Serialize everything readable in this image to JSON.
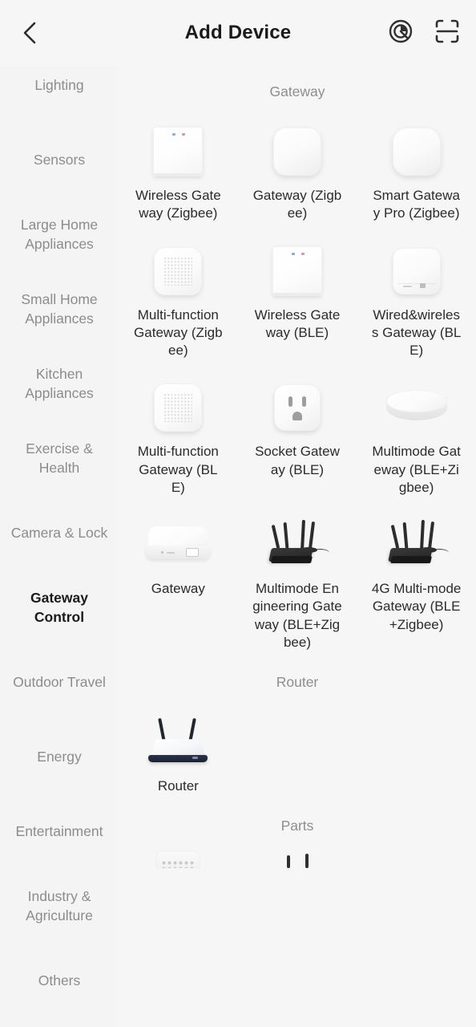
{
  "header": {
    "title": "Add Device",
    "back_icon": "chevron-left-icon",
    "auto_scan_icon": "target-scan-icon",
    "qr_scan_icon": "qr-scan-icon"
  },
  "sidebar": {
    "items": [
      {
        "label": "Lighting",
        "active": false,
        "clipped": true
      },
      {
        "label": "Sensors",
        "active": false
      },
      {
        "label": "Large Home Appliances",
        "active": false
      },
      {
        "label": "Small Home Appliances",
        "active": false
      },
      {
        "label": "Kitchen Appliances",
        "active": false
      },
      {
        "label": "Exercise & Health",
        "active": false
      },
      {
        "label": "Camera & Lock",
        "active": false
      },
      {
        "label": "Gateway Control",
        "active": true
      },
      {
        "label": "Outdoor Travel",
        "active": false
      },
      {
        "label": "Energy",
        "active": false
      },
      {
        "label": "Entertainment",
        "active": false
      },
      {
        "label": "Industry & Agriculture",
        "active": false
      },
      {
        "label": "Others",
        "active": false
      }
    ]
  },
  "content": {
    "sections": [
      {
        "title": "Gateway",
        "devices": [
          {
            "label": "Wireless Gateway (Zigbee)",
            "art": "square-gateway"
          },
          {
            "label": "Gateway (Zigbee)",
            "art": "rounded-gateway"
          },
          {
            "label": "Smart Gateway Pro (Zigbee)",
            "art": "rounded-gateway-pro"
          },
          {
            "label": "Multi-function Gateway (Zigbee)",
            "art": "mesh-gateway"
          },
          {
            "label": "Wireless Gateway (BLE)",
            "art": "square-gateway"
          },
          {
            "label": "Wired&wireless Gateway (BLE)",
            "art": "wired-gateway"
          },
          {
            "label": "Multi-function Gateway (BLE)",
            "art": "mesh-gateway"
          },
          {
            "label": "Socket Gateway (BLE)",
            "art": "socket-gateway"
          },
          {
            "label": "Multimode Gateway (BLE+Zigbee)",
            "art": "puck-gateway"
          },
          {
            "label": "Gateway",
            "art": "flat-box-gateway"
          },
          {
            "label": "Multimode Engineering Gateway (BLE+Zigbee)",
            "art": "black-router"
          },
          {
            "label": "4G Multi-mode Gateway (BLE+Zigbee)",
            "art": "black-router"
          }
        ]
      },
      {
        "title": "Router",
        "devices": [
          {
            "label": "Router",
            "art": "white-router"
          }
        ]
      },
      {
        "title": "Parts",
        "devices": []
      }
    ]
  },
  "colors": {
    "page_background": "#f6f6f6",
    "sidebar_background": "#f4f4f4",
    "active_text": "#1a1a1a",
    "inactive_text": "#8c8c8c",
    "section_title": "#8e8e8e",
    "device_label": "#2b2b2b"
  }
}
